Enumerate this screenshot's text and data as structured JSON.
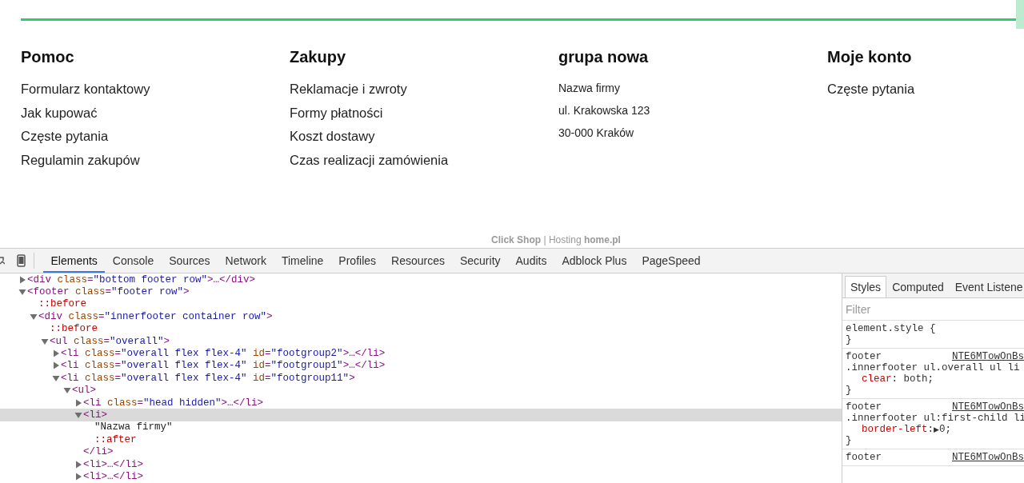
{
  "footer": {
    "columns": [
      {
        "kind": "links",
        "heading": "Pomoc",
        "items": [
          "Formularz kontaktowy",
          "Jak kupować",
          "Częste pytania",
          "Regulamin zakupów"
        ]
      },
      {
        "kind": "links",
        "heading": "Zakupy",
        "items": [
          "Reklamacje i zwroty",
          "Formy płatności",
          "Koszt dostawy",
          "Czas realizacji zamówienia"
        ]
      },
      {
        "kind": "address",
        "heading": "grupa nowa",
        "items": [
          "Nazwa firmy",
          "ul. Krakowska 123",
          "30-000 Kraków"
        ]
      },
      {
        "kind": "links",
        "heading": "Moje konto",
        "items": [
          "Częste pytania"
        ]
      }
    ],
    "credits": "**Click Shop** | Hosting **home.pl**"
  },
  "devtools": {
    "tabs": [
      {
        "label": "Elements",
        "selected": true
      },
      {
        "label": "Console",
        "selected": false
      },
      {
        "label": "Sources",
        "selected": false
      },
      {
        "label": "Network",
        "selected": false
      },
      {
        "label": "Timeline",
        "selected": false
      },
      {
        "label": "Profiles",
        "selected": false
      },
      {
        "label": "Resources",
        "selected": false
      },
      {
        "label": "Security",
        "selected": false
      },
      {
        "label": "Audits",
        "selected": false
      },
      {
        "label": "Adblock Plus",
        "selected": false
      },
      {
        "label": "PageSpeed",
        "selected": false
      }
    ],
    "dom_tree": [
      {
        "kind": "element",
        "expanded": false,
        "selected": false,
        "tokens": [
          {
            "kind": "tag",
            "text": "<div "
          },
          {
            "kind": "attr",
            "text": "class"
          },
          {
            "kind": "tag",
            "text": "="
          },
          {
            "kind": "value",
            "text": "\"bottom footer row\""
          },
          {
            "kind": "tag",
            "text": ">…</div>"
          }
        ]
      },
      {
        "kind": "element",
        "expanded": true,
        "selected": false,
        "tokens": [
          {
            "kind": "tag",
            "text": "<footer "
          },
          {
            "kind": "attr",
            "text": "class"
          },
          {
            "kind": "tag",
            "text": "="
          },
          {
            "kind": "value",
            "text": "\"footer row\""
          },
          {
            "kind": "tag",
            "text": ">"
          }
        ],
        "children": [
          {
            "kind": "pseudo",
            "selected": false,
            "text": "::before"
          },
          {
            "kind": "element",
            "expanded": true,
            "selected": false,
            "tokens": [
              {
                "kind": "tag",
                "text": "<div "
              },
              {
                "kind": "attr",
                "text": "class"
              },
              {
                "kind": "tag",
                "text": "="
              },
              {
                "kind": "value",
                "text": "\"innerfooter container row\""
              },
              {
                "kind": "tag",
                "text": ">"
              }
            ],
            "children": [
              {
                "kind": "pseudo",
                "selected": false,
                "text": "::before"
              },
              {
                "kind": "element",
                "expanded": true,
                "selected": false,
                "tokens": [
                  {
                    "kind": "tag",
                    "text": "<ul "
                  },
                  {
                    "kind": "attr",
                    "text": "class"
                  },
                  {
                    "kind": "tag",
                    "text": "="
                  },
                  {
                    "kind": "value",
                    "text": "\"overall\""
                  },
                  {
                    "kind": "tag",
                    "text": ">"
                  }
                ],
                "children": [
                  {
                    "kind": "element",
                    "expanded": false,
                    "selected": false,
                    "tokens": [
                      {
                        "kind": "tag",
                        "text": "<li "
                      },
                      {
                        "kind": "attr",
                        "text": "class"
                      },
                      {
                        "kind": "tag",
                        "text": "="
                      },
                      {
                        "kind": "value",
                        "text": "\"overall flex flex-4\""
                      },
                      {
                        "kind": "attr",
                        "text": " id"
                      },
                      {
                        "kind": "tag",
                        "text": "="
                      },
                      {
                        "kind": "value",
                        "text": "\"footgroup2\""
                      },
                      {
                        "kind": "tag",
                        "text": ">…</li>"
                      }
                    ]
                  },
                  {
                    "kind": "element",
                    "expanded": false,
                    "selected": false,
                    "tokens": [
                      {
                        "kind": "tag",
                        "text": "<li "
                      },
                      {
                        "kind": "attr",
                        "text": "class"
                      },
                      {
                        "kind": "tag",
                        "text": "="
                      },
                      {
                        "kind": "value",
                        "text": "\"overall flex flex-4\""
                      },
                      {
                        "kind": "attr",
                        "text": " id"
                      },
                      {
                        "kind": "tag",
                        "text": "="
                      },
                      {
                        "kind": "value",
                        "text": "\"footgroup1\""
                      },
                      {
                        "kind": "tag",
                        "text": ">…</li>"
                      }
                    ]
                  },
                  {
                    "kind": "element",
                    "expanded": true,
                    "selected": false,
                    "tokens": [
                      {
                        "kind": "tag",
                        "text": "<li "
                      },
                      {
                        "kind": "attr",
                        "text": "class"
                      },
                      {
                        "kind": "tag",
                        "text": "="
                      },
                      {
                        "kind": "value",
                        "text": "\"overall flex flex-4\""
                      },
                      {
                        "kind": "attr",
                        "text": " id"
                      },
                      {
                        "kind": "tag",
                        "text": "="
                      },
                      {
                        "kind": "value",
                        "text": "\"footgroup11\""
                      },
                      {
                        "kind": "tag",
                        "text": ">"
                      }
                    ],
                    "children": [
                      {
                        "kind": "element",
                        "expanded": true,
                        "selected": false,
                        "tokens": [
                          {
                            "kind": "tag",
                            "text": "<ul>"
                          }
                        ],
                        "children": [
                          {
                            "kind": "element",
                            "expanded": false,
                            "selected": false,
                            "tokens": [
                              {
                                "kind": "tag",
                                "text": "<li "
                              },
                              {
                                "kind": "attr",
                                "text": "class"
                              },
                              {
                                "kind": "tag",
                                "text": "="
                              },
                              {
                                "kind": "value",
                                "text": "\"head hidden\""
                              },
                              {
                                "kind": "tag",
                                "text": ">…</li>"
                              }
                            ]
                          },
                          {
                            "kind": "element",
                            "expanded": true,
                            "selected": true,
                            "tokens": [
                              {
                                "kind": "tag",
                                "text": "<li>"
                              }
                            ],
                            "children": [
                              {
                                "kind": "text",
                                "selected": false,
                                "text": "\"Nazwa firmy\""
                              },
                              {
                                "kind": "pseudo",
                                "selected": false,
                                "text": "::after"
                              }
                            ]
                          },
                          {
                            "kind": "closing",
                            "selected": false,
                            "text": "</li>"
                          },
                          {
                            "kind": "element",
                            "expanded": false,
                            "selected": false,
                            "tokens": [
                              {
                                "kind": "tag",
                                "text": "<li>…</li>"
                              }
                            ]
                          },
                          {
                            "kind": "element",
                            "expanded": false,
                            "selected": false,
                            "tokens": [
                              {
                                "kind": "tag",
                                "text": "<li>…</li>"
                              }
                            ]
                          }
                        ]
                      }
                    ]
                  }
                ]
              }
            ]
          }
        ]
      }
    ],
    "sidebar": {
      "tabs": [
        {
          "label": "Styles",
          "selected": true
        },
        {
          "label": "Computed",
          "selected": false
        },
        {
          "label": "Event Listene",
          "selected": false
        }
      ],
      "filter": {
        "placeholder": "Filter"
      },
      "rules": [
        {
          "selector": "element.style {",
          "close": "}"
        },
        {
          "origin": "footer",
          "source": "NTE6MTowOnBs",
          "selector": ".innerfooter ul.overall ul li",
          "props": [
            {
              "name": "clear",
              "colon": ": ",
              "value": "both;"
            }
          ],
          "close": "}"
        },
        {
          "origin": "footer",
          "source": "NTE6MTowOnBs",
          "selector": ".innerfooter ul:first-child li",
          "props": [
            {
              "name": "border-left",
              "colon": ":",
              "expander": "▶",
              "value": "0;"
            }
          ],
          "close": "}"
        },
        {
          "origin": "footer",
          "source": "NTE6MTowOnBs"
        }
      ]
    }
  }
}
